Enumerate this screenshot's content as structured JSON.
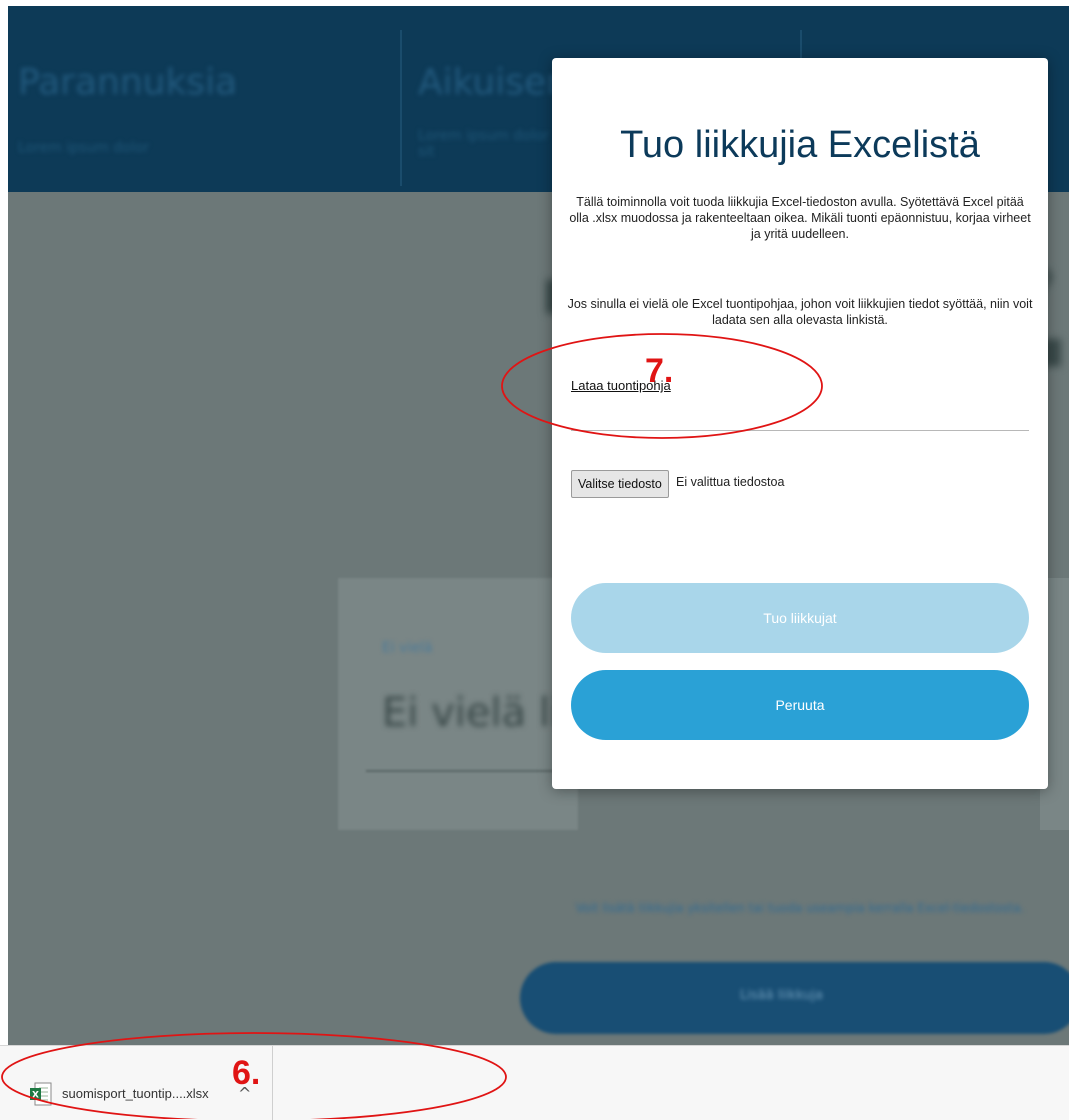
{
  "background": {
    "header_left_title": "Parannuksia",
    "header_left_sub": "Lorem ipsum dolor",
    "header_mid_title": "Aikuisen",
    "header_mid_sub": "Lorem ipsum dolor sit",
    "card_label": "Ei vielä",
    "card_text": "Ei vielä liikkujia",
    "note_text": "Voit lisätä liikkujia yksitellen tai tuoda useampia kerralla Excel-tiedostosta.",
    "pill_label": "Lisää liikkuja"
  },
  "modal": {
    "title": "Tuo liikkujia Excelistä",
    "description": "Tällä toiminnolla voit tuoda liikkujia Excel-tiedoston avulla. Syötettävä Excel pitää olla .xlsx muodossa ja rakenteeltaan oikea. Mikäli tuonti epäonnistuu, korjaa virheet ja yritä uudelleen.",
    "description2": "Jos sinulla ei vielä ole Excel tuontipohjaa, johon voit liikkujien tiedot syöttää, niin voit ladata sen alla olevasta linkistä.",
    "template_link": "Lataa tuontipohja",
    "file_button": "Valitse tiedosto",
    "file_status": "Ei valittua tiedostoa",
    "import_button": "Tuo liikkujat",
    "cancel_button": "Peruuta"
  },
  "annotations": {
    "step7": "7.",
    "step6": "6.",
    "color": "#e01414"
  },
  "download_bar": {
    "file_name": "suomisport_tuontip....xlsx",
    "file_icon": "excel-file-icon",
    "expand_icon": "chevron-up-icon"
  },
  "colors": {
    "header": "#0d3a57",
    "overlay": "#6c7878",
    "title": "#0c3a5a",
    "import_button": "#a9d6ea",
    "cancel_button": "#2aa1d6"
  }
}
